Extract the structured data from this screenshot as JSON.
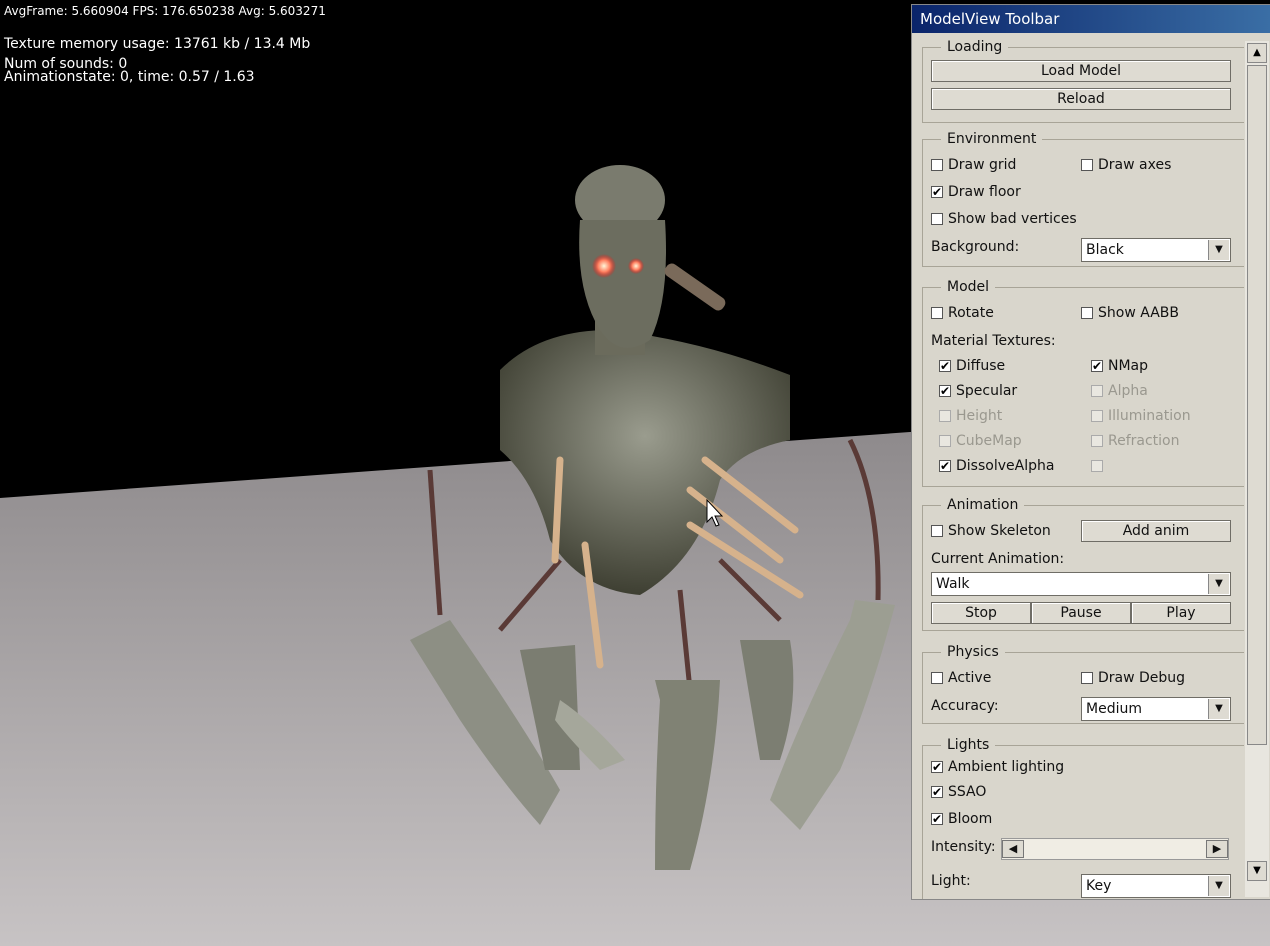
{
  "hud": {
    "line1": "AvgFrame: 5.660904  FPS: 176.650238 Avg: 5.603271",
    "line2": "Texture memory usage: 13761 kb / 13.4 Mb",
    "line3": "Num of sounds: 0",
    "line4": "Animationstate: 0, time: 0.57 / 1.63"
  },
  "toolbar": {
    "title": "ModelView Toolbar",
    "loading": {
      "legend": "Loading",
      "load_model": "Load Model",
      "reload": "Reload"
    },
    "environment": {
      "legend": "Environment",
      "draw_grid": {
        "label": "Draw grid",
        "checked": false
      },
      "draw_axes": {
        "label": "Draw axes",
        "checked": false
      },
      "draw_floor": {
        "label": "Draw floor",
        "checked": true
      },
      "show_bad_vertices": {
        "label": "Show bad vertices",
        "checked": false
      },
      "background_label": "Background:",
      "background_value": "Black"
    },
    "model": {
      "legend": "Model",
      "rotate": {
        "label": "Rotate",
        "checked": false
      },
      "show_aabb": {
        "label": "Show AABB",
        "checked": false
      },
      "material_label": "Material Textures:",
      "diffuse": {
        "label": "Diffuse",
        "checked": true
      },
      "nmap": {
        "label": "NMap",
        "checked": true
      },
      "specular": {
        "label": "Specular",
        "checked": true
      },
      "alpha": {
        "label": "Alpha",
        "checked": false
      },
      "height": {
        "label": "Height",
        "checked": false
      },
      "illumination": {
        "label": "Illumination",
        "checked": false
      },
      "cubemap": {
        "label": "CubeMap",
        "checked": false
      },
      "refraction": {
        "label": "Refraction",
        "checked": false
      },
      "dissolvealpha": {
        "label": "DissolveAlpha",
        "checked": true
      }
    },
    "animation": {
      "legend": "Animation",
      "show_skeleton": {
        "label": "Show Skeleton",
        "checked": false
      },
      "add_anim": "Add anim",
      "current_label": "Current Animation:",
      "current_value": "Walk",
      "stop": "Stop",
      "pause": "Pause",
      "play": "Play"
    },
    "physics": {
      "legend": "Physics",
      "active": {
        "label": "Active",
        "checked": false
      },
      "draw_debug": {
        "label": "Draw Debug",
        "checked": false
      },
      "accuracy_label": "Accuracy:",
      "accuracy_value": "Medium"
    },
    "lights": {
      "legend": "Lights",
      "ambient": {
        "label": "Ambient lighting",
        "checked": true
      },
      "ssao": {
        "label": "SSAO",
        "checked": true
      },
      "bloom": {
        "label": "Bloom",
        "checked": true
      },
      "intensity_label": "Intensity:",
      "intensity_level": 0,
      "light_label": "Light:",
      "light_value": "Key"
    }
  },
  "icons": {
    "checkmark": "check-icon",
    "dropdown": "chevron-down-icon",
    "scroll_up": "arrow-up-icon",
    "scroll_down": "arrow-down-icon",
    "slider_left": "arrow-left-icon",
    "slider_right": "arrow-right-icon",
    "cursor": "mouse-cursor-icon"
  },
  "colors": {
    "title_bar": "#0a246a",
    "panel_bg": "#d9d6cc"
  }
}
